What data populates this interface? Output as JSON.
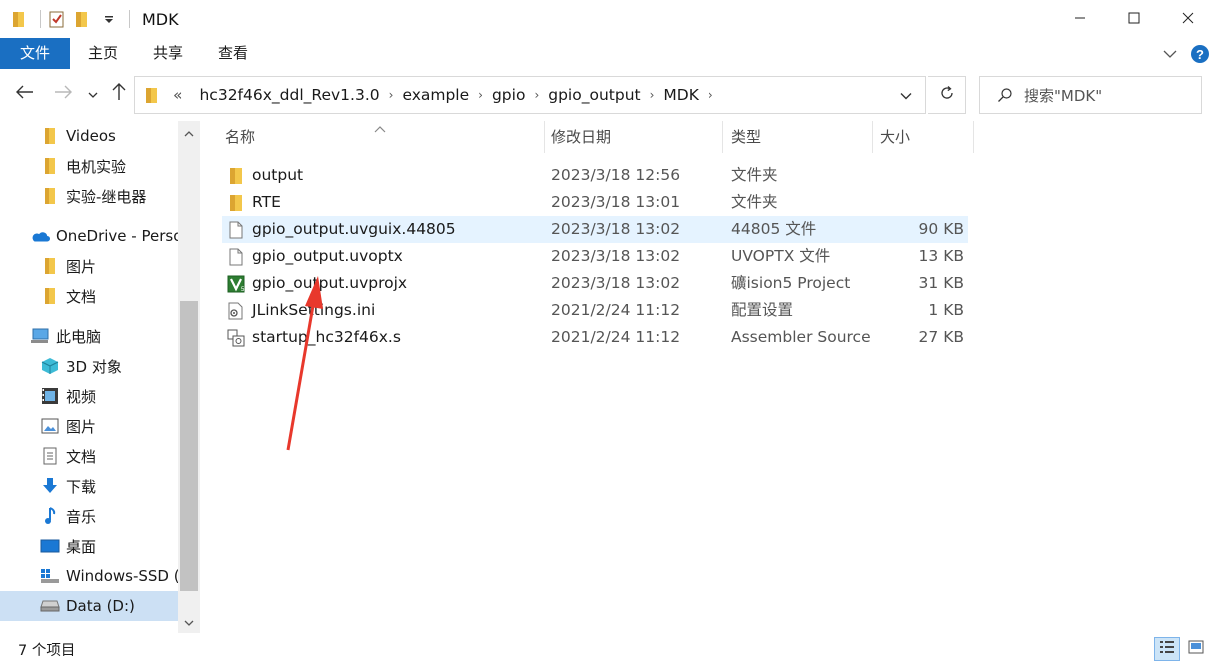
{
  "window": {
    "title": "MDK",
    "minimize_icon": "minimize-icon",
    "maximize_icon": "maximize-icon",
    "close_icon": "close-icon"
  },
  "ribbon": {
    "tabs": [
      "文件",
      "主页",
      "共享",
      "查看"
    ],
    "accent": "#1a6fc2"
  },
  "address": {
    "overflow": "«",
    "crumbs": [
      "hc32f46x_ddl_Rev1.3.0",
      "example",
      "gpio",
      "gpio_output",
      "MDK"
    ]
  },
  "search": {
    "placeholder": "搜索\"MDK\""
  },
  "nav": {
    "items": [
      {
        "label": "Videos",
        "icon": "folder-icon"
      },
      {
        "label": "电机实验",
        "icon": "folder-icon"
      },
      {
        "label": "实验-继电器",
        "icon": "folder-icon"
      },
      {
        "label": "OneDrive - Perso",
        "icon": "onedrive-icon"
      },
      {
        "label": "图片",
        "icon": "folder-icon"
      },
      {
        "label": "文档",
        "icon": "folder-icon"
      },
      {
        "label": "此电脑",
        "icon": "computer-icon"
      },
      {
        "label": "3D 对象",
        "icon": "3d-objects-icon"
      },
      {
        "label": "视频",
        "icon": "videos-icon"
      },
      {
        "label": "图片",
        "icon": "pictures-icon"
      },
      {
        "label": "文档",
        "icon": "documents-icon"
      },
      {
        "label": "下载",
        "icon": "download-icon"
      },
      {
        "label": "音乐",
        "icon": "music-icon"
      },
      {
        "label": "桌面",
        "icon": "desktop-icon"
      },
      {
        "label": "Windows-SSD (",
        "icon": "windows-drive-icon"
      },
      {
        "label": "Data (D:)",
        "icon": "drive-icon"
      }
    ],
    "selected": "Data (D:)"
  },
  "columns": [
    "名称",
    "修改日期",
    "类型",
    "大小"
  ],
  "files": [
    {
      "name": "output",
      "date": "2023/3/18 12:56",
      "type": "文件夹",
      "size": "",
      "icon": "folder-icon"
    },
    {
      "name": "RTE",
      "date": "2023/3/18 13:01",
      "type": "文件夹",
      "size": "",
      "icon": "folder-icon"
    },
    {
      "name": "gpio_output.uvguix.44805",
      "date": "2023/3/18 13:02",
      "type": "44805 文件",
      "size": "90 KB",
      "icon": "file-icon"
    },
    {
      "name": "gpio_output.uvoptx",
      "date": "2023/3/18 13:02",
      "type": "UVOPTX 文件",
      "size": "13 KB",
      "icon": "file-icon"
    },
    {
      "name": "gpio_output.uvprojx",
      "date": "2023/3/18 13:02",
      "type": "礦ision5 Project",
      "size": "31 KB",
      "icon": "keil-project-icon"
    },
    {
      "name": "JLinkSettings.ini",
      "date": "2021/2/24 11:12",
      "type": "配置设置",
      "size": "1 KB",
      "icon": "settings-file-icon"
    },
    {
      "name": "startup_hc32f46x.s",
      "date": "2021/2/24 11:12",
      "type": "Assembler Source",
      "size": "27 KB",
      "icon": "assembler-file-icon"
    }
  ],
  "status": {
    "count": "7 个项目"
  },
  "annotation_color": "#e8382c"
}
